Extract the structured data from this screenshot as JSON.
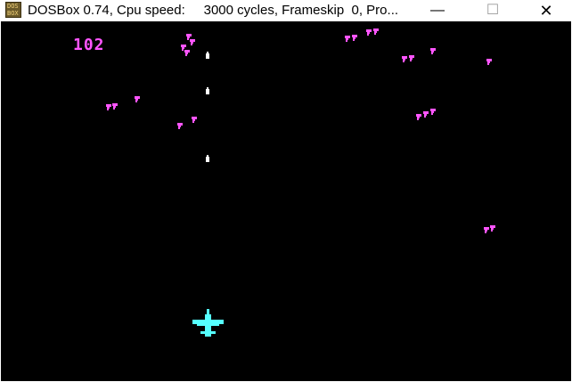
{
  "window": {
    "icon": "dosbox-icon",
    "icon_text_top": "DOS",
    "icon_text_bottom": "BOX",
    "title": "DOSBox 0.74, Cpu speed:     3000 cycles, Frameskip  0, Pro...",
    "minimize_glyph": "—",
    "maximize_glyph": "☐",
    "close_glyph": "✕"
  },
  "game": {
    "score": "102",
    "colors": {
      "background": "#000000",
      "enemy": "#ff55ff",
      "player": "#55ffff",
      "bullet": "#ffffff",
      "score": "#ff55ff"
    },
    "enemy_count": 21,
    "bullet_count": 3
  }
}
